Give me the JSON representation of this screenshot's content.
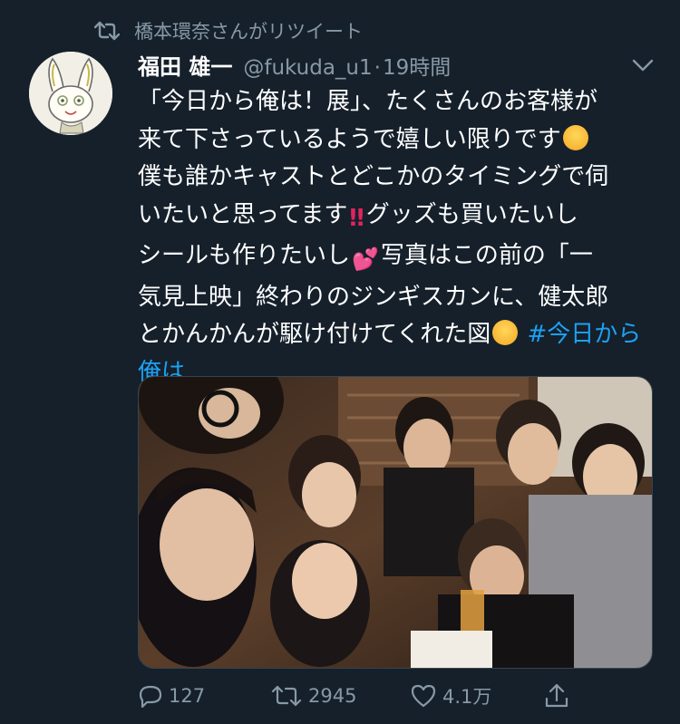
{
  "retweet_context": {
    "text": "橋本環奈さんがリツイート",
    "icon": "retweet-icon"
  },
  "author": {
    "display_name": "福田 雄一",
    "handle": "@fukuda_u1",
    "separator": "·",
    "time": "19時間"
  },
  "tweet": {
    "line1": "「今日から俺は！展」、たくさんのお客様が",
    "line2a": "来て下さっているようで嬉しい限りです",
    "line3": "僕も誰かキャストとどこかのタイミングで伺",
    "line4a": "いたいと思ってます",
    "line4b": "グッズも買いたいし",
    "line5a": "シールも作りたいし",
    "line5b": "写真はこの前の「一",
    "line6": "気見上映」終わりのジンギスカンに、健太郎",
    "line7a": "とかんかんが駆け付けてくれた図",
    "hashtag": "#今日から俺は",
    "emojis": [
      "rofl-emoji",
      "double-exclamation-emoji",
      "two-hearts-emoji",
      "star-struck-emoji"
    ]
  },
  "photo": {
    "description_icon": "group-selfie-photo"
  },
  "actions": {
    "reply_count": "127",
    "retweet_count": "2945",
    "like_count": "4.1万",
    "icons": [
      "reply-icon",
      "retweet-icon",
      "heart-icon",
      "share-icon"
    ]
  },
  "colors": {
    "background": "#15202b",
    "secondary_text": "#8899a6",
    "link": "#1da1f2"
  }
}
